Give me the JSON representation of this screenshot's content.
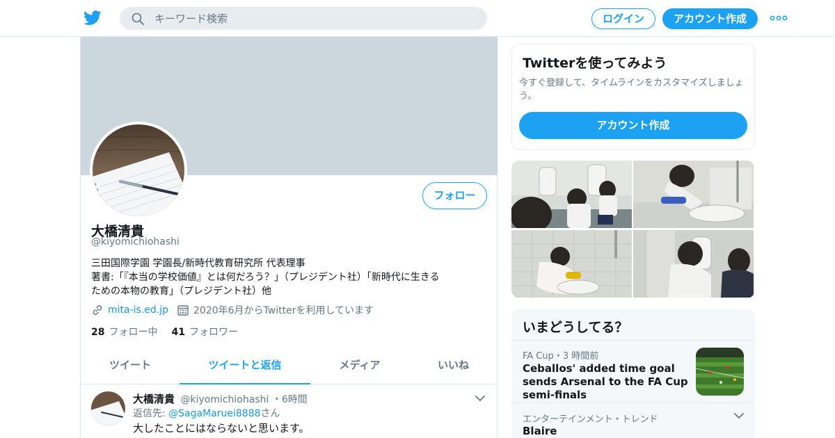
{
  "header": {
    "search_placeholder": "キーワード検索",
    "login_label": "ログイン",
    "signup_label": "アカウント作成"
  },
  "profile": {
    "name": "大橋清貴",
    "handle": "@kiyomichiohashi",
    "bio_lines": [
      "三田国際学園 学園長/新時代教育研究所 代表理事",
      "著書:「『本当の学校価値』とは何だろう？」（プレジデント社）「新時代に生きる",
      "ための本物の教育」（プレジデント社）他"
    ],
    "website": "mita-is.ed.jp",
    "joined": "2020年6月からTwitterを利用しています",
    "following_count": "28",
    "following_label": "フォロー中",
    "followers_count": "41",
    "followers_label": "フォロワー",
    "follow_button": "フォロー"
  },
  "tabs": [
    {
      "label": "ツイート",
      "active": false
    },
    {
      "label": "ツイートと返信",
      "active": true
    },
    {
      "label": "メディア",
      "active": false
    },
    {
      "label": "いいね",
      "active": false
    }
  ],
  "tweet": {
    "name": "大橋清貴",
    "handle": "@kiyomichiohashi",
    "time": "6時間",
    "reply_prefix": "返信先: ",
    "reply_to": "@SagaMaruei8888",
    "reply_suffix": "さん",
    "text": "大したことにはならないと思います。"
  },
  "signup_card": {
    "title": "Twitterを使ってみよう",
    "description": "今すぐ登録して、タイムラインをカスタマイズしましょう。",
    "button": "アカウント作成"
  },
  "trends": {
    "header": "いまどうしてる？",
    "items": [
      {
        "meta": "FA Cup・3 時間前",
        "title": "Ceballos' added time goal sends Arsenal to the FA Cup semi-finals"
      },
      {
        "meta": "エンターテインメント・トレンド",
        "title": "Blaire"
      }
    ]
  },
  "colors": {
    "accent": "#1da1f2",
    "banner": "#ccd6dd",
    "secondary_text": "#657786"
  }
}
